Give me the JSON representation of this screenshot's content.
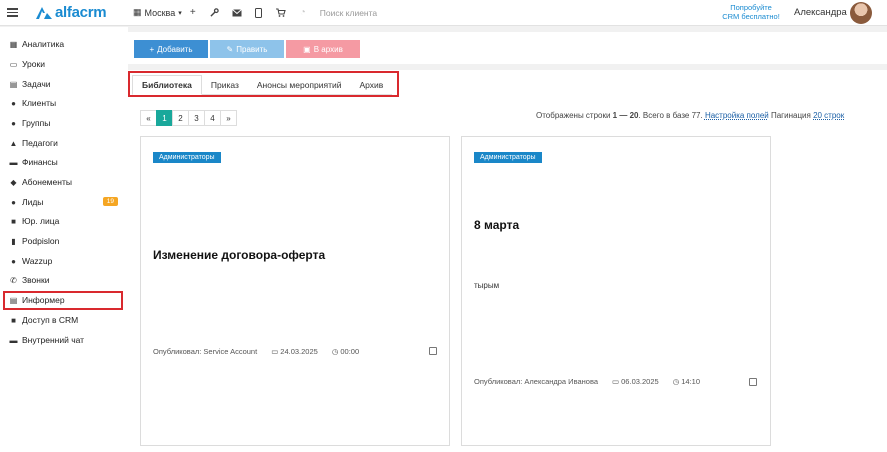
{
  "topbar": {
    "logo_text": "alfacrm",
    "city": "Москва",
    "search_placeholder": "Поиск клиента",
    "promo_line1": "Попробуйте",
    "promo_line2": "CRM бесплатно!",
    "user_name": "Александра"
  },
  "sidebar": {
    "items": [
      {
        "label": "Аналитика",
        "icon": "chart-icon"
      },
      {
        "label": "Уроки",
        "icon": "calendar-icon"
      },
      {
        "label": "Задачи",
        "icon": "task-icon"
      },
      {
        "label": "Клиенты",
        "icon": "user-icon"
      },
      {
        "label": "Группы",
        "icon": "group-icon"
      },
      {
        "label": "Педагоги",
        "icon": "teacher-icon"
      },
      {
        "label": "Финансы",
        "icon": "money-icon"
      },
      {
        "label": "Абонементы",
        "icon": "tag-icon"
      },
      {
        "label": "Лиды",
        "icon": "lead-icon",
        "badge": "19"
      },
      {
        "label": "Юр. лица",
        "icon": "briefcase-icon"
      },
      {
        "label": "Podpislon",
        "icon": "sign-icon"
      },
      {
        "label": "Wazzup",
        "icon": "chat-icon"
      },
      {
        "label": "Звонки",
        "icon": "phone-icon"
      },
      {
        "label": "Информер",
        "icon": "informer-icon"
      },
      {
        "label": "Доступ в CRM",
        "icon": "lock-icon"
      },
      {
        "label": "Внутренний чат",
        "icon": "message-icon"
      }
    ]
  },
  "actions": {
    "add": "Добавить",
    "edit": "Править",
    "archive": "В архив"
  },
  "tabs": [
    {
      "label": "Библиотека",
      "active": true
    },
    {
      "label": "Приказ",
      "active": false
    },
    {
      "label": "Анонсы мероприятий",
      "active": false
    },
    {
      "label": "Архив",
      "active": false
    }
  ],
  "pagination": {
    "prev": "«",
    "pages": [
      "1",
      "2",
      "3",
      "4"
    ],
    "active": "1",
    "next": "»"
  },
  "rows_info": {
    "prefix": "Отображены строки ",
    "range": "1 — 20",
    "suffix": ". Всего в базе 77.",
    "fields_link": "Настройка полей",
    "pagination_label": "Пагинация",
    "pagination_link": "20 строк"
  },
  "cards": [
    {
      "tag": "Администраторы",
      "title": "Изменение договора-оферта",
      "body": "",
      "author": "Опубликовал: Service Account",
      "date": "24.03.2025",
      "time": "00:00"
    },
    {
      "tag": "Администраторы",
      "title": "8 марта",
      "body": "тырым",
      "author": "Опубликовал: Александра Иванова",
      "date": "06.03.2025",
      "time": "14:10"
    }
  ],
  "colors": {
    "brand": "#1a8bd1",
    "add_button": "#3d8fd3",
    "edit_button": "#8ec3ea",
    "archive_button": "#f59aa3",
    "pager_active": "#19a89b",
    "tag": "#1a87c8",
    "highlight": "#d9292e",
    "badge": "#f5a623"
  }
}
